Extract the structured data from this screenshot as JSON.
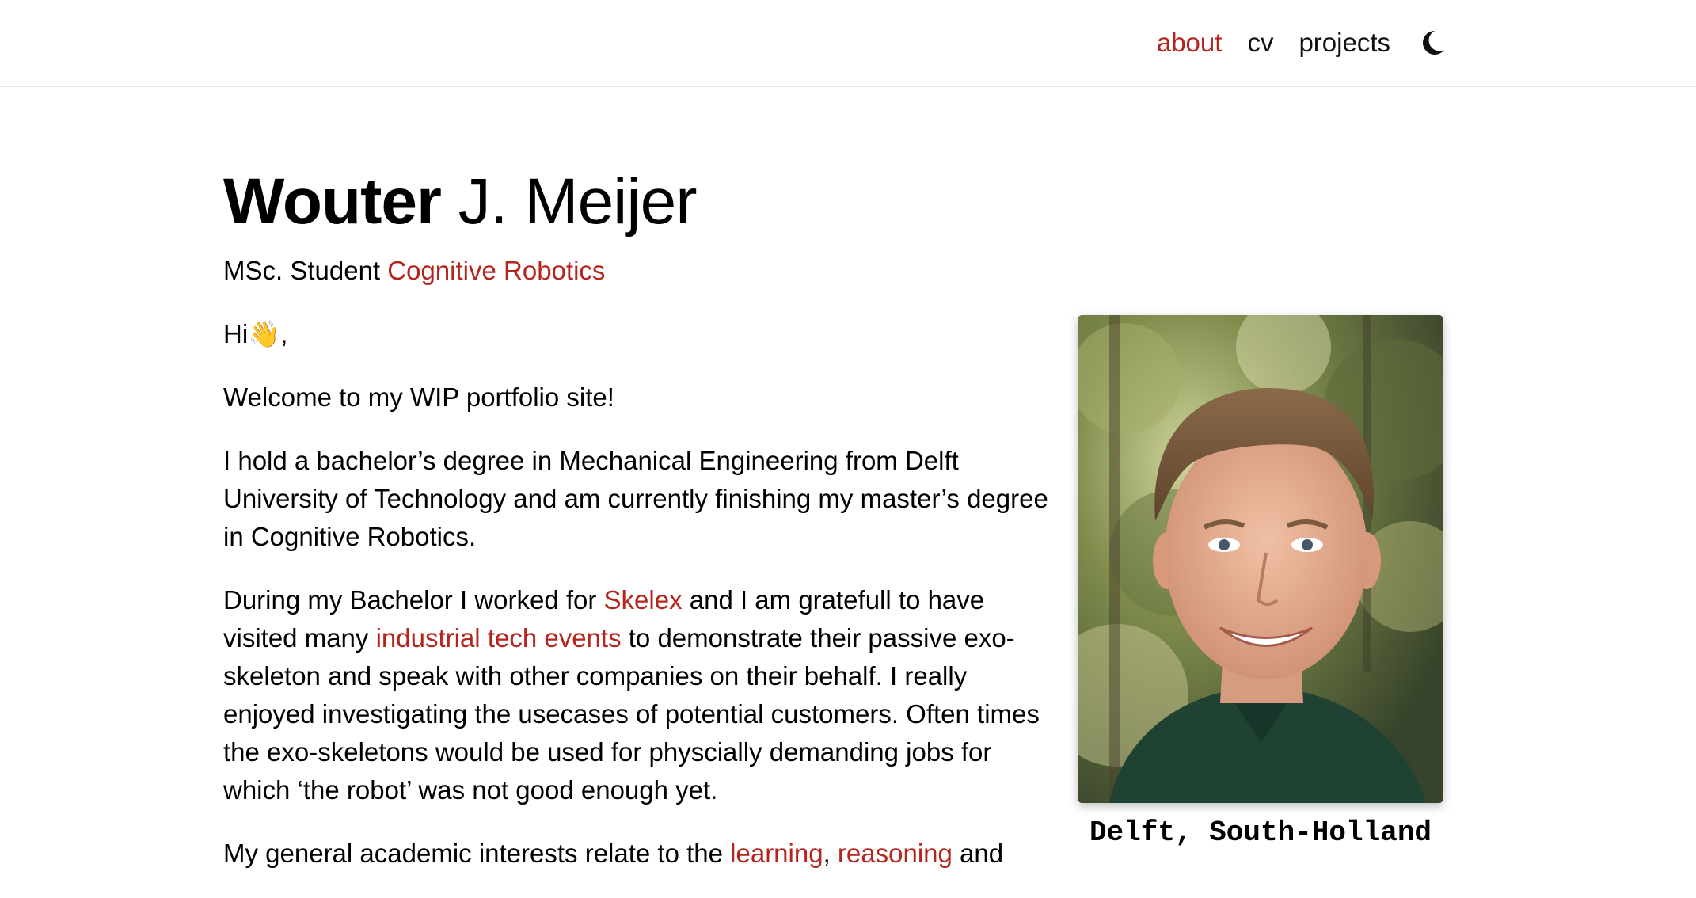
{
  "nav": {
    "items": [
      {
        "label": "about",
        "active": true
      },
      {
        "label": "cv",
        "active": false
      },
      {
        "label": "projects",
        "active": false
      }
    ],
    "theme_toggle_icon": "moon-icon"
  },
  "header": {
    "first_name": "Wouter",
    "rest_name": " J. Meijer",
    "subtitle_prefix": "MSc. Student ",
    "subtitle_link": "Cognitive Robotics"
  },
  "body": {
    "greeting": "Hi👋,",
    "welcome": "Welcome to my WIP portfolio site!",
    "education": "I hold a bachelor’s degree in Mechanical Engineering from Delft University of Technology and am currently finishing my master’s degree in Cognitive Robotics.",
    "work": {
      "t1": "During my Bachelor I worked for ",
      "link1": "Skelex",
      "t2": " and I am gratefull to have visited many ",
      "link2": "industrial tech events",
      "t3": " to demonstrate their passive exo-skeleton and speak with other companies on their behalf. I really enjoyed investigating the usecases of potential customers. Often times the exo-skeletons would be used for physcially demanding jobs for which ‘the robot’ was not good enough yet."
    },
    "interests": {
      "t1": "My general academic interests relate to the ",
      "link1": "learning",
      "t2": ", ",
      "link2": "reasoning",
      "t3": " and"
    }
  },
  "profile": {
    "caption": "Delft, South-Holland"
  },
  "colors": {
    "accent": "#b5241d",
    "text": "#000000",
    "nav_border": "#e8e8e8"
  }
}
